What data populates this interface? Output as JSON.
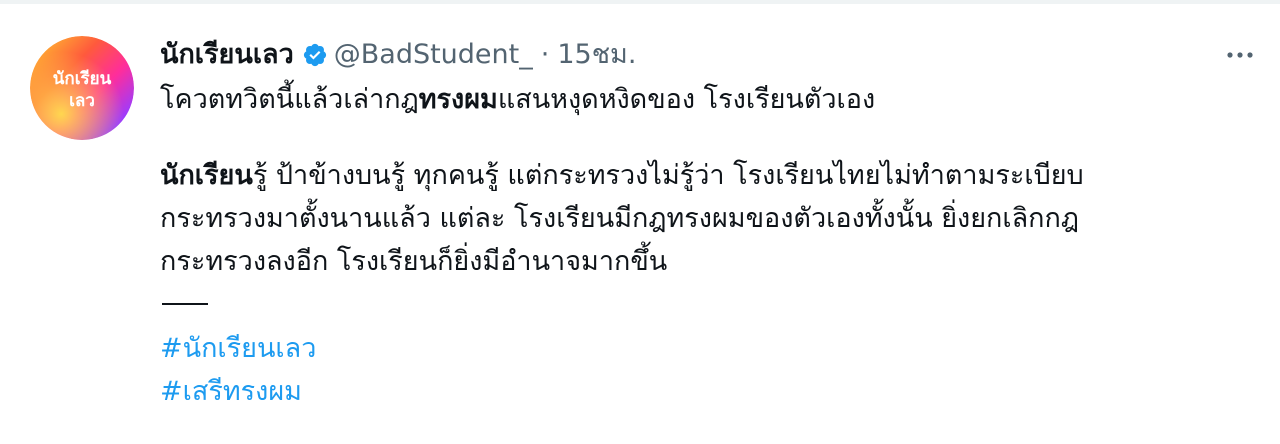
{
  "author": {
    "display_name": "นักเรียนเลว",
    "handle": "@BadStudent_",
    "separator": "·",
    "time": "15ชม.",
    "avatar_text_line1": "นักเรียน",
    "avatar_text_line2": "เลว"
  },
  "tweet": {
    "line1_prefix": "โควตทวิตนี้แล้วเล่ากฎ",
    "line1_bold": "ทรงผม",
    "line1_suffix": "แสนหงุดหงิดของ โรงเรียนตัวเอง",
    "para2_bold": "นักเรียน",
    "para2_line1_rest": "รู้ ป้าข้างบนรู้ ทุกคนรู้ แต่กระทรวงไม่รู้ว่า โรงเรียนไทยไม่ทำตามระเบียบ",
    "para2_line2": "กระทรวงมาตั้งนานแล้ว แต่ละ โรงเรียนมีกฎทรงผมของตัวเองทั้งนั้น ยิ่งยกเลิกกฎ",
    "para2_line3": "กระทรวงลงอีก  โรงเรียนก็ยิ่งมีอำนาจมากขึ้น",
    "hashtags": [
      "#นักเรียนเลว",
      "#เสรีทรงผม"
    ]
  },
  "icons": {
    "verified": "verified-badge-icon",
    "more": "more-options-icon"
  },
  "colors": {
    "link": "#1d9bf0",
    "secondary_text": "#536471",
    "primary_text": "#0f1419",
    "verified": "#1d9bf0"
  }
}
